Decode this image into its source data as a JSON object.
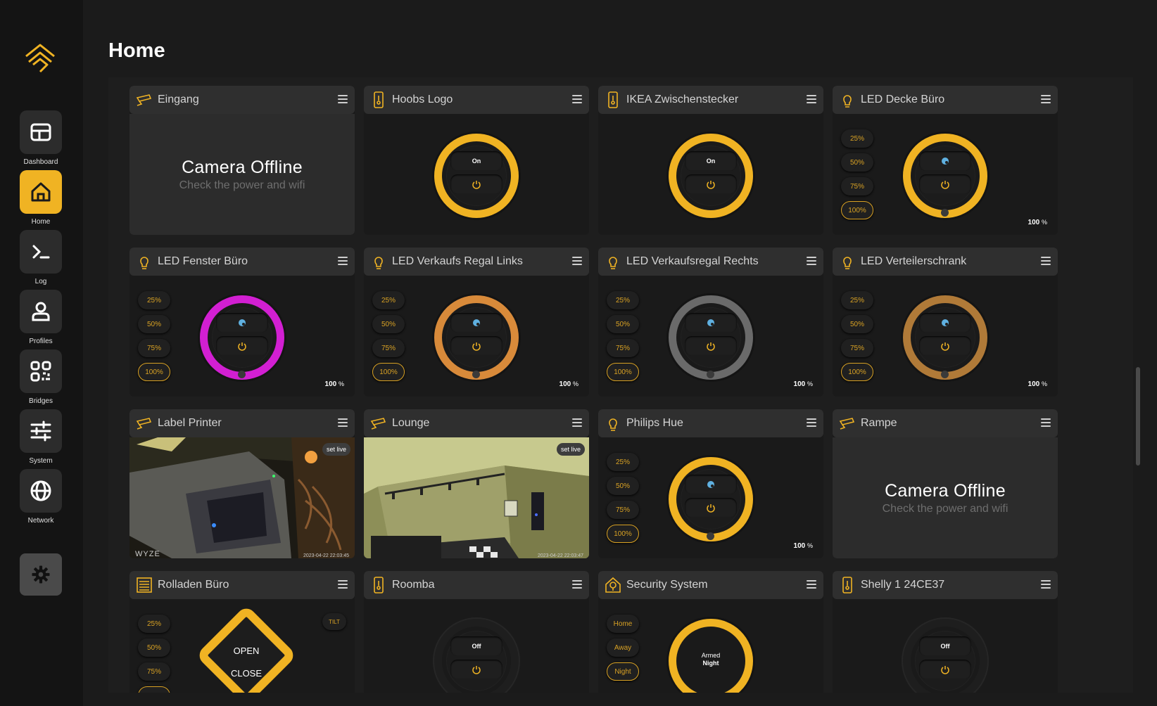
{
  "page": {
    "title": "Home"
  },
  "nav": {
    "items": [
      {
        "label": "Dashboard",
        "icon": "dashboard-icon"
      },
      {
        "label": "Home",
        "icon": "home-icon",
        "active": true
      },
      {
        "label": "Log",
        "icon": "terminal-icon"
      },
      {
        "label": "Profiles",
        "icon": "user-icon"
      },
      {
        "label": "Bridges",
        "icon": "qr-icon"
      },
      {
        "label": "System",
        "icon": "sliders-icon"
      },
      {
        "label": "Network",
        "icon": "globe-icon"
      }
    ],
    "settings_icon": "gear-icon"
  },
  "colors": {
    "accent": "#f0b323",
    "magenta": "#d21fd2",
    "orange": "#d88a3a",
    "gray": "#6a6a6a",
    "bronze": "#b07a38"
  },
  "brightness_levels": [
    "25%",
    "50%",
    "75%",
    "100%"
  ],
  "cards": [
    {
      "title": "Eingang",
      "type": "camera-offline",
      "offline_title": "Camera Offline",
      "offline_sub": "Check the power and wifi"
    },
    {
      "title": "Hoobs Logo",
      "type": "switch",
      "state": "On"
    },
    {
      "title": "IKEA Zwischenstecker",
      "type": "switch",
      "state": "On"
    },
    {
      "title": "LED Decke Büro",
      "type": "light",
      "brightness": "100",
      "unit": "%"
    },
    {
      "title": "LED Fenster Büro",
      "type": "light",
      "brightness": "100",
      "unit": "%"
    },
    {
      "title": "LED Verkaufs Regal Links",
      "type": "light",
      "brightness": "100",
      "unit": "%"
    },
    {
      "title": "LED Verkaufsregal Rechts",
      "type": "light",
      "brightness": "100",
      "unit": "%"
    },
    {
      "title": "LED Verteilerschrank",
      "type": "light",
      "brightness": "100",
      "unit": "%"
    },
    {
      "title": "Label Printer",
      "type": "camera",
      "badge": "set live",
      "timestamp": "2023-04-22 22:03:45",
      "brand": "WYZE"
    },
    {
      "title": "Lounge",
      "type": "camera",
      "badge": "set live",
      "timestamp": "2023-04-22 22:03:47"
    },
    {
      "title": "Philips Hue",
      "type": "light",
      "brightness": "100",
      "unit": "%"
    },
    {
      "title": "Rampe",
      "type": "camera-offline",
      "offline_title": "Camera Offline",
      "offline_sub": "Check the power and wifi"
    },
    {
      "title": "Rolladen Büro",
      "type": "blind",
      "tilt": "TILT",
      "open": "OPEN",
      "close": "CLOSE"
    },
    {
      "title": "Roomba",
      "type": "switch-off",
      "state": "Off"
    },
    {
      "title": "Security System",
      "type": "security",
      "modes": [
        "Home",
        "Away",
        "Night"
      ],
      "status_line1": "Armed",
      "status_line2": "Night"
    },
    {
      "title": "Shelly 1 24CE37",
      "type": "switch-off",
      "state": "Off"
    }
  ]
}
